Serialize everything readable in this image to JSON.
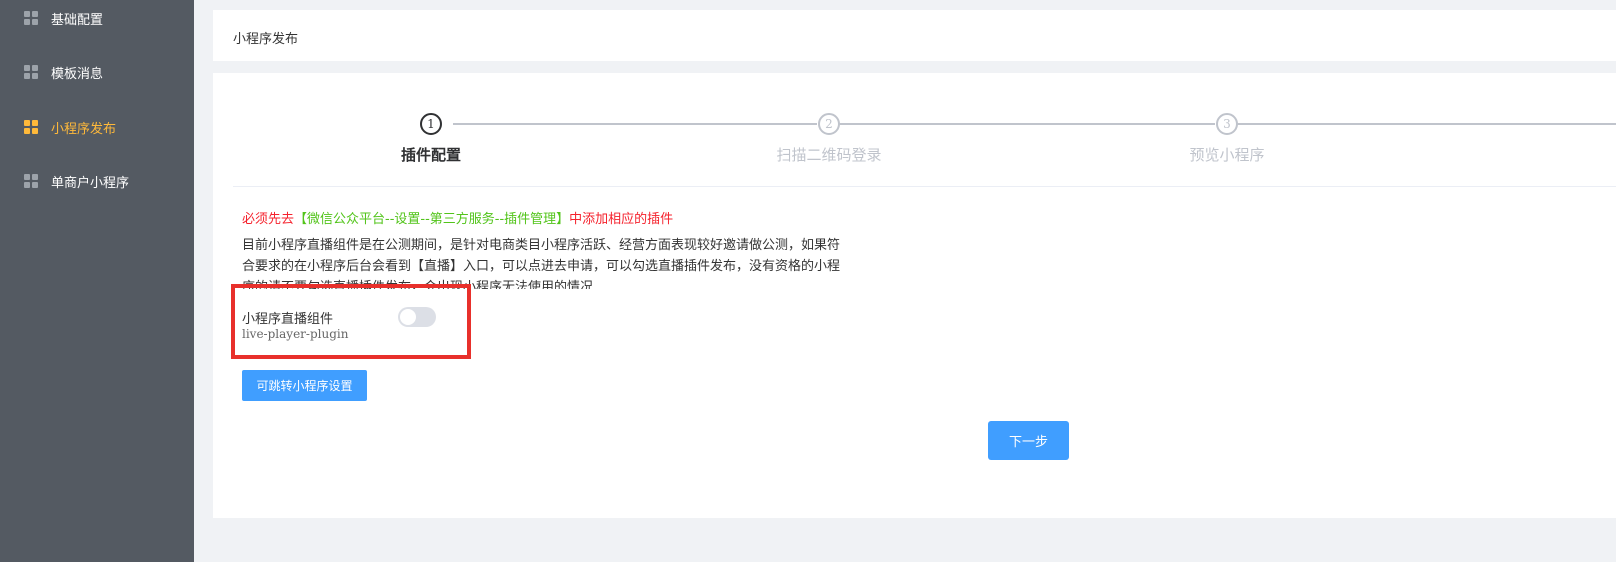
{
  "sidebar": {
    "items": [
      {
        "label": "基础配置",
        "icon": "grid-icon",
        "active": false
      },
      {
        "label": "模板消息",
        "icon": "grid-icon",
        "active": false
      },
      {
        "label": "小程序发布",
        "icon": "grid-icon",
        "active": true
      },
      {
        "label": "单商户小程序",
        "icon": "grid-icon",
        "active": false
      }
    ]
  },
  "breadcrumb": {
    "title": "小程序发布"
  },
  "steps": [
    {
      "number": "1",
      "title": "插件配置",
      "active": true
    },
    {
      "number": "2",
      "title": "扫描二维码登录",
      "active": false
    },
    {
      "number": "3",
      "title": "预览小程序",
      "active": false
    }
  ],
  "notice": {
    "prefix": "必须先去",
    "link": "【微信公众平台--设置--第三方服务--插件管理】",
    "suffix": "中添加相应的插件"
  },
  "description": "目前小程序直播组件是在公测期间，是针对电商类目小程序活跃、经营方面表现较好邀请做公测，如果符合要求的在小程序后台会看到【直播】入口，可以点进去申请，可以勾选直播插件发布，没有资格的小程序的请不要勾选直播插件发布，会出现小程序无法使用的情况",
  "plugin": {
    "name": "小程序直播组件",
    "id": "live-player-plugin",
    "enabled": false
  },
  "buttons": {
    "settings": "可跳转小程序设置",
    "next": "下一步"
  },
  "colors": {
    "sidebar_bg": "#545a62",
    "active_nav": "#ffb93a",
    "primary": "#409eff",
    "highlight_border": "#e8302b",
    "notice_red": "#f5222d",
    "notice_green": "#52c41a"
  }
}
